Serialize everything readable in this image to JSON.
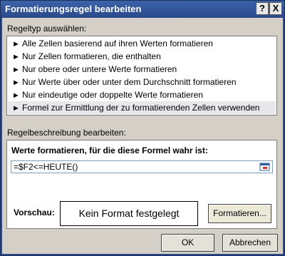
{
  "window": {
    "title": "Formatierungsregel bearbeiten",
    "help_label": "?",
    "close_label": "X"
  },
  "rule_type": {
    "label": "Regeltyp auswählen:",
    "items": [
      {
        "label": "Alle Zellen basierend auf ihren Werten formatieren"
      },
      {
        "label": "Nur Zellen formatieren, die enthalten"
      },
      {
        "label": "Nur obere oder untere Werte formatieren"
      },
      {
        "label": "Nur Werte über oder unter dem Durchschnitt formatieren"
      },
      {
        "label": "Nur eindeutige oder doppelte Werte formatieren"
      },
      {
        "label": "Formel zur Ermittlung der zu formatierenden Zellen verwenden"
      }
    ],
    "selected_index": 5
  },
  "rule_description": {
    "label": "Regelbeschreibung bearbeiten:",
    "formula_label": "Werte formatieren, für die diese Formel wahr ist:",
    "formula_value": "=$F2<=HEUTE()",
    "preview_label": "Vorschau:",
    "preview_text": "Kein Format festgelegt",
    "format_button": "Formatieren..."
  },
  "buttons": {
    "ok": "OK",
    "cancel": "Abbrechen"
  },
  "colors": {
    "titlebar": "#2a4a8a",
    "dialog_bg": "#d4d0c8",
    "selected_item": "#e7e7ec"
  },
  "icons": {
    "list_item": "arrow-right-icon",
    "range_selector": "range-select-icon"
  }
}
